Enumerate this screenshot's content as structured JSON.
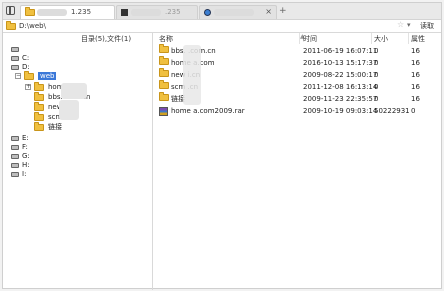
{
  "tabs": [
    {
      "label": "1.235",
      "active": true
    },
    {
      "label": ".235",
      "active": false
    },
    {
      "label": "",
      "active": false,
      "icon": "globe-icon"
    }
  ],
  "address": {
    "path": "D:\\web\\",
    "go_label": "读取"
  },
  "left_header": "目录(5),文件(1)",
  "tree": [
    {
      "label": "",
      "kind": "drive"
    },
    {
      "label": "C:",
      "kind": "drive"
    },
    {
      "label": "D:",
      "kind": "drive-open"
    },
    {
      "label": "web",
      "kind": "folder-selected"
    },
    {
      "label": "home  .com",
      "kind": "folder",
      "expand": "+"
    },
    {
      "label": "bbs.  com.cn",
      "kind": "folder"
    },
    {
      "label": "new  i.cn",
      "kind": "folder"
    },
    {
      "label": "scm.  .cn",
      "kind": "folder"
    },
    {
      "label": "链接",
      "kind": "folder"
    },
    {
      "label": "E:",
      "kind": "drive"
    },
    {
      "label": "F:",
      "kind": "drive"
    },
    {
      "label": "G:",
      "kind": "drive"
    },
    {
      "label": "H:",
      "kind": "drive"
    },
    {
      "label": "I:",
      "kind": "drive"
    }
  ],
  "columns": {
    "name": "名称",
    "time": "时间",
    "size": "大小",
    "attr": "属性"
  },
  "files": [
    {
      "name": "bbs.  .com.cn",
      "time": "2011-06-19 16:07:11",
      "size": "0",
      "attr": "16",
      "icon": "folder-icon"
    },
    {
      "name": "home  a.com",
      "time": "2016-10-13 15:17:37",
      "size": "0",
      "attr": "16",
      "icon": "folder-icon"
    },
    {
      "name": "new  i.cn",
      "time": "2009-08-22 15:00:17",
      "size": "0",
      "attr": "16",
      "icon": "folder-icon"
    },
    {
      "name": "scm  .cn",
      "time": "2011-12-08 16:13:14",
      "size": "0",
      "attr": "16",
      "icon": "folder-icon"
    },
    {
      "name": "链接",
      "time": "2009-11-23 22:35:57",
      "size": "0",
      "attr": "16",
      "icon": "folder-icon"
    },
    {
      "name": "home  a.com2009.rar",
      "time": "2009-10-19 09:03:14",
      "size": "50222931",
      "attr": "0",
      "icon": "rar-icon"
    }
  ]
}
